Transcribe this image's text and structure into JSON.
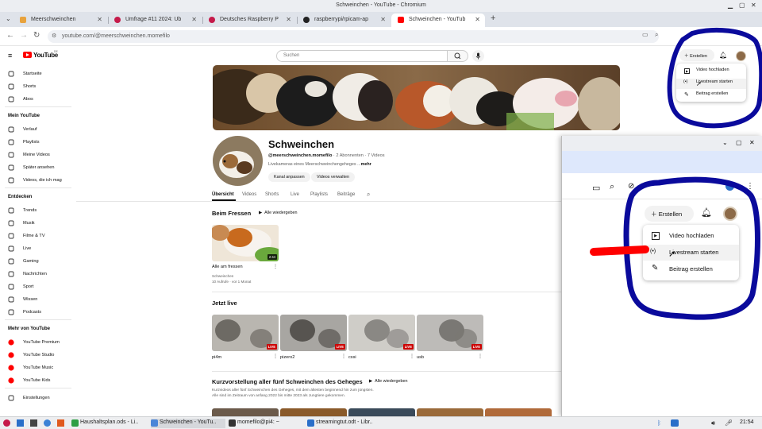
{
  "window": {
    "title": "Schweinchen - YouTube - Chromium"
  },
  "tabs": [
    {
      "label": "Meerschweinchen",
      "favicon_color": "#e8a33d"
    },
    {
      "label": "Umfrage #11 2024: Ub",
      "favicon_color": "#c51a4a"
    },
    {
      "label": "Deutsches Raspberry P",
      "favicon_color": "#c51a4a"
    },
    {
      "label": "raspberrypi/rpicam-ap",
      "favicon_color": "#222222"
    },
    {
      "label": "Schweinchen - YouTub",
      "favicon_color": "#ff0000",
      "active": true
    }
  ],
  "address": {
    "url": "youtube.com/@meerschweinchen.momefilo"
  },
  "youtube": {
    "logo_text": "YouTube",
    "logo_suffix": "DE",
    "search_placeholder": "Suchen",
    "create_label": "Erstellen",
    "create_menu": [
      "Video hochladen",
      "Livestream starten",
      "Beitrag erstellen"
    ]
  },
  "sidebar": {
    "main": [
      {
        "label": "Startseite",
        "icon": "home-icon"
      },
      {
        "label": "Shorts",
        "icon": "shorts-icon"
      },
      {
        "label": "Abos",
        "icon": "subscriptions-icon"
      }
    ],
    "you_header": "Mein YouTube",
    "you": [
      {
        "label": "Verlauf",
        "icon": "history-icon"
      },
      {
        "label": "Playlists",
        "icon": "playlists-icon"
      },
      {
        "label": "Meine Videos",
        "icon": "my-videos-icon"
      },
      {
        "label": "Später ansehen",
        "icon": "watch-later-icon"
      },
      {
        "label": "Videos, die ich mag",
        "icon": "liked-icon"
      }
    ],
    "explore_header": "Entdecken",
    "explore": [
      {
        "label": "Trends",
        "icon": "trending-icon"
      },
      {
        "label": "Musik",
        "icon": "music-icon"
      },
      {
        "label": "Filme & TV",
        "icon": "movies-icon"
      },
      {
        "label": "Live",
        "icon": "live-icon"
      },
      {
        "label": "Gaming",
        "icon": "gaming-icon"
      },
      {
        "label": "Nachrichten",
        "icon": "news-icon"
      },
      {
        "label": "Sport",
        "icon": "sport-icon"
      },
      {
        "label": "Wissen",
        "icon": "learning-icon"
      },
      {
        "label": "Podcasts",
        "icon": "podcasts-icon"
      }
    ],
    "more_header": "Mehr von YouTube",
    "more": [
      {
        "label": "YouTube Premium"
      },
      {
        "label": "YouTube Studio"
      },
      {
        "label": "YouTube Music"
      },
      {
        "label": "YouTube Kids"
      }
    ],
    "settings": "Einstellungen"
  },
  "channel": {
    "name": "Schweinchen",
    "handle": "@meerschweinchen.momefilo",
    "stats": " · 2 Abonnenten · 7 Videos",
    "description": "Livekameras eines Meerschweinchengeheges ...",
    "more": "mehr",
    "customize_button": "Kanal anpassen",
    "manage_button": "Videos verwalten",
    "tabs": [
      "Übersicht",
      "Videos",
      "Shorts",
      "Live",
      "Playlists",
      "Beiträge"
    ]
  },
  "sections": {
    "feeding_title": "Beim Fressen",
    "play_all": "Alle wiedergeben",
    "feeding_video": {
      "title": "Alle am fressen",
      "channel": "Schweinchen",
      "meta": "10 Aufrufe · vor 1 Monat",
      "duration": "2:44"
    },
    "live_title": "Jetzt live",
    "live_badge": "LIVE",
    "live_videos": [
      {
        "title": "pi4m"
      },
      {
        "title": "pizero2"
      },
      {
        "title": "cssi"
      },
      {
        "title": "usb"
      }
    ],
    "intro_title": "Kurzvorstellung aller fünf Schweinchen des Geheges",
    "intro_desc_1": "Kurzvideos aller fünf Schweinchen des Geheges, mit dem ältesten beginnend hin zum jüngsten.",
    "intro_desc_2": "Alle sind im Zeitraum von anfang 2022 bis mitte 2023 als Jungtiere gekommen."
  },
  "taskbar": {
    "apps": [
      {
        "label": "Haushaltsplan.ods - Li..",
        "icon_color": "#2e9e44"
      },
      {
        "label": "Schweinchen - YouTu..",
        "icon_color": "#4a86d8",
        "active": true
      },
      {
        "label": "momefilo@pi4: ~",
        "icon_color": "#333333"
      },
      {
        "label": "streamingtut.odt - Libr..",
        "icon_color": "#2a6fc9"
      }
    ],
    "clock": "21:54"
  },
  "colors": {
    "yt_red": "#ff0000",
    "annotation_blue": "#0a0a9c",
    "annotation_red": "#ff0000"
  }
}
